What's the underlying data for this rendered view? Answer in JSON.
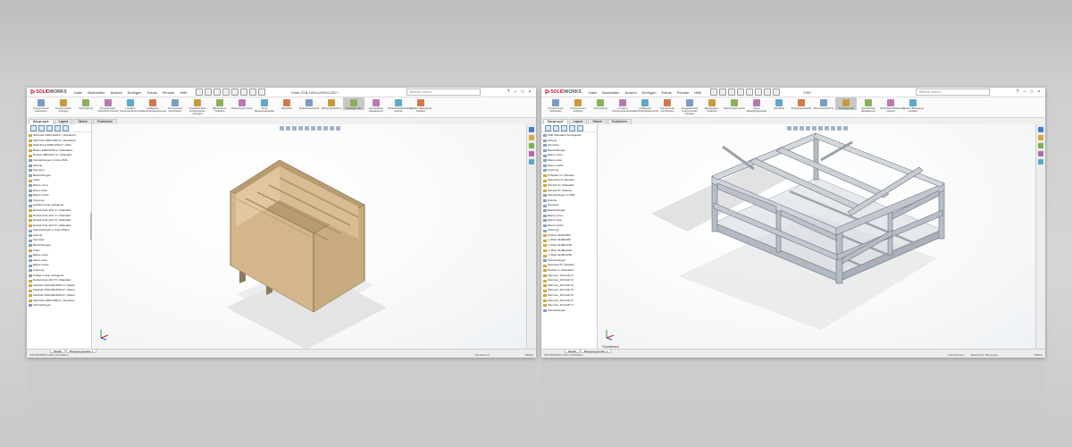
{
  "colors": {
    "brand_red": "#c8102e",
    "wood": "#d2b88e",
    "metal": "#c6cbd3",
    "background": "#cfcfcf"
  },
  "left": {
    "app_logo": {
      "solid": "SOLID",
      "works": "WORKS"
    },
    "menus": [
      "Datei",
      "Bearbeiten",
      "Ansicht",
      "Einfügen",
      "Extras",
      "Fenster",
      "Hilfe"
    ],
    "doc_title": "Kiste-ZSB-1000x2000x1200 *",
    "search_placeholder": "Befehle suchen",
    "ribbon": [
      "Komponenten bearbeiten",
      "Komponenten einfügen",
      "Verknüpfung",
      "Komponenten-Voransicht-Fenster",
      "Linearen Komponentenmuster",
      "Intelligente Verbindungselemente",
      "Komponente verschieben",
      "Ausgeblendete Komponenten anzeigen",
      "Baugruppen-Features",
      "Referenzgeometrie",
      "Neue Bewegungsstudie",
      "Stückliste",
      "Explosionsansicht",
      "Momentaufnahme",
      "Sofortiges 3D",
      "Sprechblase aktualisieren",
      "Sicherheitsdarstellung machen",
      "Struktur-Bewegung erstellen"
    ],
    "tabs": [
      "Baugruppe",
      "Layout",
      "Skizze",
      "Evaluieren"
    ],
    "tree": [
      "Stirnbrett-1062x1290-1> (Standard<",
      "Stirnbrett-1062x1290-2> (Standard<",
      "Seitenbrett-1990x1290-1> (Stan",
      "Boden-1990x1090-1> (Standard<",
      "Deckel-1990x1127-1> (Standard",
      "Verknüpfungen in Kiste-ZSB...",
      "Historie",
      "Sensoren",
      "Beschriftungen",
      "Kufen",
      "Ebene vorne",
      "Ebene oben",
      "Ebene rechts",
      "Ursprung",
      "Aufsatz-Linear ausfugend",
      "Deckel-Kufe-1127-1> (Standard",
      "Deckel-Kufe-1127-2> (Standard",
      "Deckel-Kufe-1127-3> (Standard",
      "Deckel-Kufe-1127-4> (Standard",
      "Verknüpfungen in Kiste-ZSB-2",
      "Historie",
      "Sensoren",
      "Beschriftungen",
      "Kufen",
      "Ebene vorne",
      "Ebene oben",
      "Ebene rechts",
      "Ursprung",
      "Aufsatz-Linear ausfugend",
      "Deckel-Kufe-1127-5> (Standard",
      "Kantholz-100x100x2000-1> (Stand",
      "Kantholz-100x100x2000-2> (Stand",
      "Kantholz-100x100x2000-3> (Stand",
      "Stirnbrett-1062x1290-3> (Standard",
      "Verknüpfungen"
    ],
    "bottom_tabs": [
      "Modell",
      "Bewegungsstudie 1"
    ],
    "status_left": "SOLIDWORKS 2017 x64 Edition",
    "status_mid": "Voll definiert",
    "status_right": "MMGS"
  },
  "right": {
    "app_logo": {
      "solid": "SOLID",
      "works": "WORKS"
    },
    "menus": [
      "Datei",
      "Bearbeiten",
      "Ansicht",
      "Einfügen",
      "Extras",
      "Fenster",
      "Hilfe"
    ],
    "doc_title": "ZSB *",
    "search_placeholder": "Befehle suchen",
    "ribbon": [
      "Komponenten bearbeiten",
      "Komponenten einfügen",
      "Verknüpfung",
      "Linearen Komponentenmuster",
      "Intelligente Verbindungselemente",
      "Komponente verschieben",
      "Ausgeblendete Komponenten anzeigen",
      "Baugruppen-Features",
      "Referenzgeometrie",
      "Neue Bewegungsstudie",
      "Stückliste",
      "Explosionsansicht",
      "Momentaufnahme",
      "Sofortiges 3D",
      "Sprechblase aktualisieren",
      "Sicherheitsdarstellung machen",
      "Struktur-Bewegung erstellen"
    ],
    "tabs": [
      "Baugruppe",
      "Layout",
      "Skizze",
      "Evaluieren"
    ],
    "tree": [
      "ZSB (Standard<Anzeigestat",
      "Historie",
      "Sensoren",
      "Beschriftungen",
      "Ebene vorne",
      "Ebene oben",
      "Ebene rechts",
      "Ursprung",
      "(f) Boden<1> (Standar",
      "Seitenteil<4> (Standar",
      "Stirnteil<2> (Standard",
      "Stirnteil<3> (Standa",
      "Verknüpfungen in ZSB",
      "Historie",
      "Sensoren",
      "Beschriftungen",
      "Ebene vorne",
      "Ebene oben",
      "Ebene rechts",
      "Ursprung",
      "(f) Brett 24x80x680",
      "(-) Brett 24x80x680",
      "(-) Brett 24x80x1150",
      "(-) Brett 24x80x1150",
      "(-) Brett 24x80x1150",
      "Verknüpfungen",
      "Seitenteil<5> (Standar",
      "Deckel<1> (Standard<",
      "Klammer_Schmidt<1>",
      "Klammer_Schmidt<2>",
      "Klammer_Schmidt<3>",
      "Klammer_Schmidt<4>",
      "Klammer_Schmidt<5>",
      "Klammer_Schmidt<6>",
      "Klammer_Schmidt<7>",
      "Verknüpfungen"
    ],
    "view_label": "*Isometrisch",
    "bottom_tabs": [
      "Modell",
      "Bewegungsstudie 1"
    ],
    "status_left": "SOLIDWORKS 2017 x64 Edition",
    "status_mid": "Unterdefiniert",
    "status_edit": "Bearbeiten: Baugruppe",
    "status_right": "MMGS"
  }
}
